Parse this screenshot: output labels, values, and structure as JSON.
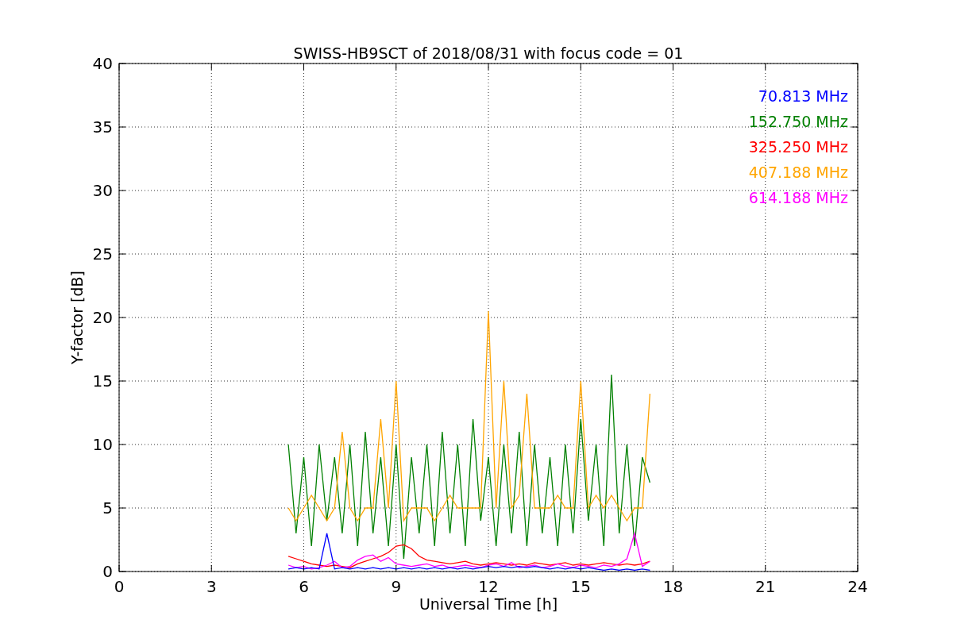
{
  "chart_data": {
    "type": "line",
    "title": "SWISS-HB9SCT of 2018/08/31 with focus code = 01",
    "xlabel": "Universal Time [h]",
    "ylabel": "Y-factor [dB]",
    "xlim": [
      0,
      24
    ],
    "ylim": [
      0,
      40
    ],
    "xticks": [
      0,
      3,
      6,
      9,
      12,
      15,
      18,
      21,
      24
    ],
    "yticks": [
      0,
      5,
      10,
      15,
      20,
      25,
      30,
      35,
      40
    ],
    "grid": true,
    "x": [
      5.5,
      5.75,
      6,
      6.25,
      6.5,
      6.75,
      7,
      7.25,
      7.5,
      7.75,
      8,
      8.25,
      8.5,
      8.75,
      9,
      9.25,
      9.5,
      9.75,
      10,
      10.25,
      10.5,
      10.75,
      11,
      11.25,
      11.5,
      11.75,
      12,
      12.25,
      12.5,
      12.75,
      13,
      13.25,
      13.5,
      13.75,
      14,
      14.25,
      14.5,
      14.75,
      15,
      15.25,
      15.5,
      15.75,
      16,
      16.25,
      16.5,
      16.75,
      17,
      17.25
    ],
    "series": [
      {
        "name": "70.813 MHz",
        "color": "#0000ff",
        "values": [
          0.2,
          0.3,
          0.2,
          0.3,
          0.2,
          3,
          0.2,
          0.3,
          0.2,
          0.3,
          0.2,
          0.3,
          0.2,
          0.3,
          0.2,
          0.3,
          0.2,
          0.3,
          0.2,
          0.3,
          0.2,
          0.3,
          0.2,
          0.3,
          0.2,
          0.3,
          0.4,
          0.3,
          0.4,
          0.3,
          0.4,
          0.3,
          0.4,
          0.3,
          0.2,
          0.3,
          0.2,
          0.3,
          0.2,
          0.3,
          0.2,
          0.1,
          0.2,
          0.1,
          0.2,
          0.1,
          0.2,
          0.1
        ]
      },
      {
        "name": "152.750 MHz",
        "color": "#008000",
        "values": [
          10,
          3,
          9,
          2,
          10,
          4,
          9,
          3,
          10,
          2,
          11,
          3,
          9,
          2,
          10,
          1,
          9,
          3,
          10,
          2,
          11,
          3,
          10,
          2,
          12,
          4,
          9,
          2,
          10,
          3,
          11,
          2,
          10,
          3,
          9,
          2,
          10,
          3,
          12,
          4,
          10,
          2,
          15.5,
          3,
          10,
          2,
          9,
          7
        ]
      },
      {
        "name": "325.250 MHz",
        "color": "#ff0000",
        "values": [
          1.2,
          1,
          0.8,
          0.6,
          0.5,
          0.4,
          0.5,
          0.4,
          0.3,
          0.6,
          0.8,
          1,
          1.2,
          1.5,
          2,
          2.1,
          1.8,
          1.2,
          0.9,
          0.8,
          0.7,
          0.6,
          0.7,
          0.8,
          0.6,
          0.5,
          0.6,
          0.7,
          0.6,
          0.5,
          0.6,
          0.5,
          0.7,
          0.6,
          0.5,
          0.6,
          0.7,
          0.5,
          0.6,
          0.5,
          0.6,
          0.7,
          0.6,
          0.5,
          0.6,
          0.5,
          0.6,
          0.8
        ]
      },
      {
        "name": "407.188 MHz",
        "color": "#ffa500",
        "values": [
          5,
          4,
          5,
          6,
          5,
          4,
          5,
          11,
          5,
          4,
          5,
          5,
          12,
          5,
          15,
          4,
          5,
          5,
          5,
          4,
          5,
          6,
          5,
          5,
          5,
          5,
          20.5,
          5,
          15,
          5,
          6,
          14,
          5,
          5,
          5,
          6,
          5,
          5,
          15,
          5,
          6,
          5,
          6,
          5,
          4,
          5,
          5,
          14
        ]
      },
      {
        "name": "614.188 MHz",
        "color": "#ff00ff",
        "values": [
          0.5,
          0.3,
          0.4,
          0.2,
          0.3,
          0.5,
          0.8,
          0.3,
          0.4,
          0.9,
          1.2,
          1.3,
          0.8,
          1.1,
          0.6,
          0.5,
          0.4,
          0.5,
          0.6,
          0.4,
          0.5,
          0.3,
          0.4,
          0.5,
          0.4,
          0.3,
          0.5,
          0.6,
          0.4,
          0.7,
          0.3,
          0.4,
          0.5,
          0.3,
          0.4,
          0.6,
          0.4,
          0.3,
          0.5,
          0.4,
          0.3,
          0.5,
          0.4,
          0.6,
          1,
          3,
          0.4,
          0.8
        ]
      }
    ]
  }
}
